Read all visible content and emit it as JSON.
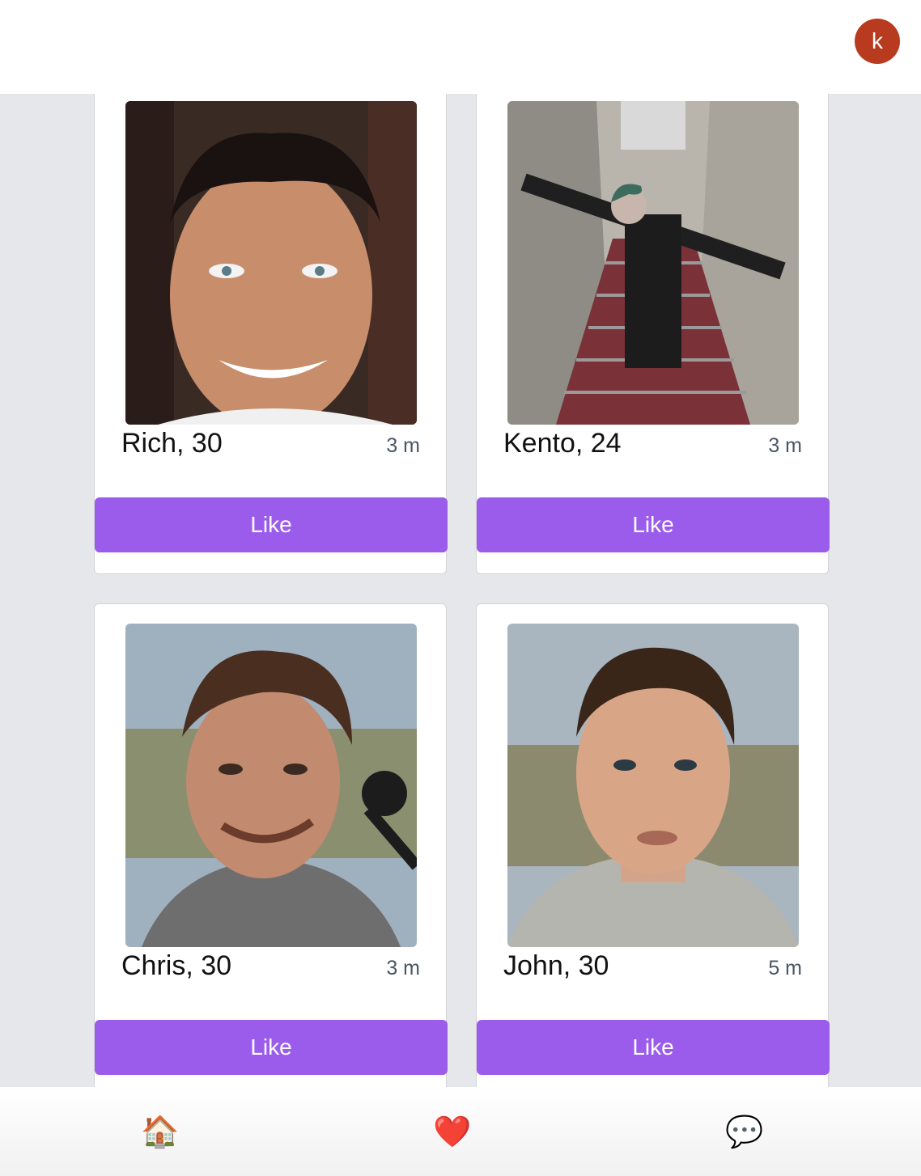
{
  "header": {
    "avatar_initial": "k"
  },
  "profiles": [
    {
      "name": "Rich, 30",
      "distance": "3 m",
      "like_label": "Like"
    },
    {
      "name": "Kento, 24",
      "distance": "3 m",
      "like_label": "Like"
    },
    {
      "name": "Chris, 30",
      "distance": "3 m",
      "like_label": "Like"
    },
    {
      "name": "John, 30",
      "distance": "5 m",
      "like_label": "Like"
    }
  ],
  "nav": {
    "tabs": [
      {
        "icon": "house-icon",
        "glyph": "🏠"
      },
      {
        "icon": "heart-icon",
        "glyph": "❤️"
      },
      {
        "icon": "chat-bubble-icon",
        "glyph": "💬"
      }
    ]
  },
  "colors": {
    "accent": "#9b5ceb",
    "avatar": "#b83b1f",
    "background": "#e5e7eb"
  }
}
